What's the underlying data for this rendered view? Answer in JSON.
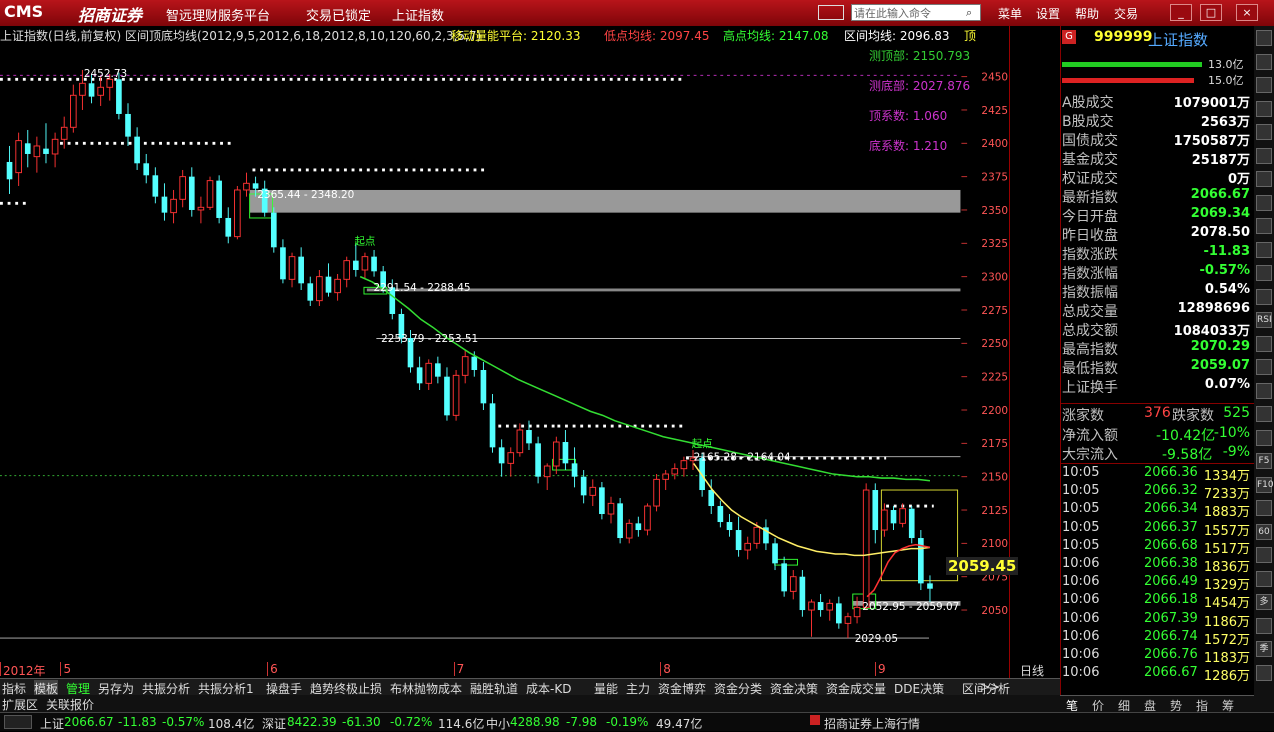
{
  "titlebar": {
    "logo": "CMS",
    "brand": "招商证券",
    "menus": [
      "智远理财服务平台",
      "交易已锁定",
      "上证指数"
    ],
    "cmd_placeholder": "请在此输入命令",
    "right_menus": [
      "菜单",
      "设置",
      "帮助",
      "交易"
    ],
    "window_buttons": [
      "_",
      "□",
      "×"
    ]
  },
  "infobar": {
    "indicator": "上证指数(日线,前复权) 区间顶底均线(2012,9,5,2012,6,18,2012,8,10,120,60,2,3,5,7)",
    "move_platform": "移动量能平台: 2120.33",
    "low_avg": "低点均线: 2097.45",
    "high_avg": "高点均线: 2147.08",
    "range_avg": "区间均线: 2096.83",
    "top": "顶"
  },
  "chart_data": {
    "type": "candlestick",
    "y_ticks": [
      2450,
      2425,
      2400,
      2375,
      2350,
      2325,
      2300,
      2275,
      2250,
      2225,
      2200,
      2175,
      2150,
      2125,
      2100,
      2075,
      2050
    ],
    "ylim": [
      2022,
      2465
    ],
    "x_labels": [
      {
        "label": "2012年",
        "pos": 0.0
      },
      {
        "label": "5",
        "pos": 0.06
      },
      {
        "label": "6",
        "pos": 0.265
      },
      {
        "label": "7",
        "pos": 0.45
      },
      {
        "label": "8",
        "pos": 0.655
      },
      {
        "label": "9",
        "pos": 0.868
      }
    ],
    "annotations": [
      {
        "text": "测顶部: 2150.793",
        "color": "#33cc33"
      },
      {
        "text": "测底部: 2027.876",
        "color": "#cc33cc"
      },
      {
        "text": "顶系数: 1.060",
        "color": "#cc33cc"
      },
      {
        "text": "底系数: 1.210",
        "color": "#cc33cc"
      }
    ],
    "level_labels": [
      {
        "text": "2452.73",
        "y": 2452.73
      },
      {
        "text": "2365.44 - 2348.20",
        "y": 2365.44
      },
      {
        "text": "2291.54 - 2288.45",
        "y": 2291.54
      },
      {
        "text": "2253.79 - 2253.51",
        "y": 2253.79
      },
      {
        "text": "2165.28 - 2164.04",
        "y": 2165.28
      },
      {
        "text": "2052.95 - 2059.07",
        "y": 2052.95
      },
      {
        "text": "2029.05",
        "y": 2029.05
      },
      {
        "text": "起点",
        "y": 2320
      },
      {
        "text": "起点",
        "y": 2168
      }
    ],
    "price_marker": "2059.45",
    "period": "日线",
    "candles": [
      [
        2386,
        2398,
        2362,
        2373
      ],
      [
        2378,
        2408,
        2368,
        2402
      ],
      [
        2400,
        2410,
        2382,
        2392
      ],
      [
        2390,
        2405,
        2378,
        2398
      ],
      [
        2396,
        2415,
        2385,
        2392
      ],
      [
        2392,
        2408,
        2382,
        2403
      ],
      [
        2403,
        2420,
        2396,
        2412
      ],
      [
        2412,
        2444,
        2408,
        2436
      ],
      [
        2436,
        2455,
        2425,
        2445
      ],
      [
        2445,
        2452,
        2430,
        2435
      ],
      [
        2436,
        2450,
        2428,
        2442
      ],
      [
        2442,
        2452,
        2432,
        2448
      ],
      [
        2448,
        2453,
        2418,
        2422
      ],
      [
        2422,
        2430,
        2398,
        2405
      ],
      [
        2405,
        2412,
        2380,
        2385
      ],
      [
        2385,
        2392,
        2370,
        2376
      ],
      [
        2376,
        2382,
        2355,
        2360
      ],
      [
        2360,
        2370,
        2342,
        2348
      ],
      [
        2348,
        2365,
        2340,
        2358
      ],
      [
        2358,
        2380,
        2352,
        2375
      ],
      [
        2375,
        2382,
        2345,
        2350
      ],
      [
        2350,
        2360,
        2340,
        2352
      ],
      [
        2352,
        2375,
        2350,
        2372
      ],
      [
        2372,
        2376,
        2340,
        2344
      ],
      [
        2344,
        2352,
        2325,
        2330
      ],
      [
        2330,
        2368,
        2328,
        2365
      ],
      [
        2365,
        2378,
        2360,
        2370
      ],
      [
        2370,
        2375,
        2360,
        2366
      ],
      [
        2366,
        2372,
        2345,
        2348
      ],
      [
        2348,
        2352,
        2318,
        2322
      ],
      [
        2322,
        2328,
        2295,
        2298
      ],
      [
        2298,
        2318,
        2292,
        2315
      ],
      [
        2315,
        2322,
        2290,
        2295
      ],
      [
        2295,
        2300,
        2278,
        2282
      ],
      [
        2282,
        2305,
        2278,
        2300
      ],
      [
        2300,
        2310,
        2285,
        2288
      ],
      [
        2288,
        2302,
        2282,
        2298
      ],
      [
        2298,
        2315,
        2292,
        2312
      ],
      [
        2312,
        2325,
        2300,
        2305
      ],
      [
        2305,
        2318,
        2298,
        2315
      ],
      [
        2315,
        2320,
        2300,
        2304
      ],
      [
        2304,
        2308,
        2288,
        2292
      ],
      [
        2292,
        2298,
        2268,
        2272
      ],
      [
        2272,
        2276,
        2250,
        2254
      ],
      [
        2254,
        2260,
        2228,
        2232
      ],
      [
        2232,
        2240,
        2215,
        2220
      ],
      [
        2220,
        2238,
        2215,
        2235
      ],
      [
        2235,
        2240,
        2220,
        2225
      ],
      [
        2225,
        2232,
        2192,
        2196
      ],
      [
        2196,
        2230,
        2192,
        2226
      ],
      [
        2226,
        2245,
        2220,
        2240
      ],
      [
        2240,
        2244,
        2225,
        2230
      ],
      [
        2230,
        2236,
        2200,
        2205
      ],
      [
        2205,
        2212,
        2168,
        2172
      ],
      [
        2172,
        2178,
        2150,
        2160
      ],
      [
        2160,
        2172,
        2150,
        2168
      ],
      [
        2168,
        2190,
        2165,
        2185
      ],
      [
        2185,
        2192,
        2170,
        2175
      ],
      [
        2175,
        2180,
        2145,
        2150
      ],
      [
        2150,
        2160,
        2140,
        2158
      ],
      [
        2158,
        2180,
        2152,
        2176
      ],
      [
        2176,
        2185,
        2155,
        2160
      ],
      [
        2160,
        2172,
        2142,
        2150
      ],
      [
        2150,
        2155,
        2130,
        2136
      ],
      [
        2136,
        2148,
        2128,
        2142
      ],
      [
        2142,
        2146,
        2118,
        2122
      ],
      [
        2122,
        2135,
        2115,
        2130
      ],
      [
        2130,
        2134,
        2100,
        2104
      ],
      [
        2104,
        2118,
        2100,
        2115
      ],
      [
        2115,
        2120,
        2105,
        2110
      ],
      [
        2110,
        2130,
        2106,
        2128
      ],
      [
        2128,
        2152,
        2124,
        2148
      ],
      [
        2148,
        2155,
        2140,
        2152
      ],
      [
        2152,
        2160,
        2148,
        2156
      ],
      [
        2156,
        2165,
        2150,
        2162
      ],
      [
        2162,
        2170,
        2155,
        2164
      ],
      [
        2164,
        2168,
        2135,
        2140
      ],
      [
        2140,
        2148,
        2122,
        2128
      ],
      [
        2128,
        2132,
        2112,
        2116
      ],
      [
        2116,
        2122,
        2105,
        2110
      ],
      [
        2110,
        2120,
        2090,
        2095
      ],
      [
        2095,
        2105,
        2088,
        2100
      ],
      [
        2100,
        2116,
        2096,
        2112
      ],
      [
        2112,
        2118,
        2095,
        2100
      ],
      [
        2100,
        2104,
        2080,
        2085
      ],
      [
        2085,
        2090,
        2060,
        2064
      ],
      [
        2064,
        2080,
        2058,
        2075
      ],
      [
        2075,
        2080,
        2045,
        2050
      ],
      [
        2050,
        2058,
        2030,
        2056
      ],
      [
        2056,
        2062,
        2045,
        2050
      ],
      [
        2050,
        2058,
        2042,
        2055
      ],
      [
        2055,
        2060,
        2036,
        2040
      ],
      [
        2040,
        2048,
        2029,
        2045
      ],
      [
        2045,
        2060,
        2040,
        2052
      ],
      [
        2052,
        2145,
        2050,
        2140
      ],
      [
        2140,
        2145,
        2100,
        2110
      ],
      [
        2110,
        2130,
        2105,
        2125
      ],
      [
        2125,
        2128,
        2110,
        2115
      ],
      [
        2115,
        2130,
        2112,
        2126
      ],
      [
        2126,
        2128,
        2100,
        2104
      ],
      [
        2104,
        2110,
        2065,
        2070
      ],
      [
        2070,
        2076,
        2056,
        2066
      ]
    ],
    "green_ma": [
      2300,
      2296,
      2290,
      2283,
      2276,
      2268,
      2262,
      2255,
      2249,
      2243,
      2238,
      2233,
      2228,
      2223,
      2219,
      2215,
      2211,
      2207,
      2203,
      2199,
      2196,
      2192,
      2189,
      2186,
      2183,
      2180,
      2178,
      2176,
      2174,
      2172,
      2170,
      2168,
      2166,
      2164,
      2162,
      2160,
      2158,
      2156,
      2154,
      2152,
      2151,
      2150,
      2150,
      2149,
      2149,
      2148,
      2148,
      2147
    ],
    "yellow_ma": [
      2160,
      2150,
      2140,
      2132,
      2125,
      2120,
      2116,
      2112,
      2108,
      2104,
      2101,
      2098,
      2096,
      2094,
      2093,
      2092,
      2092,
      2091,
      2091,
      2092,
      2093,
      2094,
      2095,
      2096,
      2096,
      2097
    ],
    "red_ma": [
      2060,
      2065,
      2075,
      2086,
      2093,
      2096,
      2098,
      2099,
      2098,
      2097
    ]
  },
  "quote": {
    "code": "999999",
    "name": "上证指数",
    "vol_up": "13.0亿",
    "vol_down": "15.0亿",
    "rows": [
      {
        "label": "A股成交",
        "value": "1079001万",
        "color": "#ffffff"
      },
      {
        "label": "B股成交",
        "value": "2563万",
        "color": "#ffffff"
      },
      {
        "label": "国债成交",
        "value": "1750587万",
        "color": "#ffffff"
      },
      {
        "label": "基金成交",
        "value": "25187万",
        "color": "#ffffff"
      },
      {
        "label": "权证成交",
        "value": "0万",
        "color": "#ffffff"
      },
      {
        "label": "最新指数",
        "value": "2066.67",
        "color": "#33ff33"
      },
      {
        "label": "今日开盘",
        "value": "2069.34",
        "color": "#33ff33"
      },
      {
        "label": "昨日收盘",
        "value": "2078.50",
        "color": "#ffffff"
      },
      {
        "label": "指数涨跌",
        "value": "-11.83",
        "color": "#33ff33"
      },
      {
        "label": "指数涨幅",
        "value": "-0.57%",
        "color": "#33ff33"
      },
      {
        "label": "指数振幅",
        "value": "0.54%",
        "color": "#ffffff"
      },
      {
        "label": "总成交量",
        "value": "12898696",
        "color": "#ffffff"
      },
      {
        "label": "总成交额",
        "value": "1084033万",
        "color": "#ffffff"
      },
      {
        "label": "最高指数",
        "value": "2070.29",
        "color": "#33ff33"
      },
      {
        "label": "最低指数",
        "value": "2059.07",
        "color": "#33ff33"
      },
      {
        "label": "上证换手",
        "value": "0.07%",
        "color": "#ffffff"
      }
    ],
    "rise_label": "涨家数",
    "rise_count": "376",
    "fall_label": "跌家数",
    "fall_count": "525",
    "inflow_label": "净流入额",
    "inflow_value": "-10.42亿",
    "inflow_pct": "-10%",
    "block_label": "大宗流入",
    "block_value": "-9.58亿",
    "block_pct": "-9%"
  },
  "ticks": [
    {
      "time": "10:05",
      "price": "2066.36",
      "vol": "1334万"
    },
    {
      "time": "10:05",
      "price": "2066.32",
      "vol": "7233万"
    },
    {
      "time": "10:05",
      "price": "2066.34",
      "vol": "1883万"
    },
    {
      "time": "10:05",
      "price": "2066.37",
      "vol": "1557万"
    },
    {
      "time": "10:05",
      "price": "2066.68",
      "vol": "1517万"
    },
    {
      "time": "10:06",
      "price": "2066.38",
      "vol": "1836万"
    },
    {
      "time": "10:06",
      "price": "2066.49",
      "vol": "1329万"
    },
    {
      "time": "10:06",
      "price": "2066.18",
      "vol": "1454万"
    },
    {
      "time": "10:06",
      "price": "2067.39",
      "vol": "1186万"
    },
    {
      "time": "10:06",
      "price": "2066.74",
      "vol": "1572万"
    },
    {
      "time": "10:06",
      "price": "2066.76",
      "vol": "1183万"
    },
    {
      "time": "10:06",
      "price": "2066.67",
      "vol": "1286万"
    }
  ],
  "toolbar": {
    "tabs": [
      "指标",
      "模板",
      "管理",
      "另存为",
      "共振分析",
      "共振分析1",
      "操盘手",
      "趋势终极止损",
      "布林抛物成本",
      "融胜轨道",
      "成本-KD",
      "量能",
      "主力",
      "资金博弈",
      "资金分类",
      "资金决策",
      "资金成交量",
      "DDE决策",
      "区间分析"
    ],
    "more": ">>",
    "period_label": "日线",
    "ext": [
      "扩展区",
      "关联报价"
    ]
  },
  "right_tabs": [
    "笔",
    "价",
    "细",
    "盘",
    "势",
    "指",
    "筹"
  ],
  "statusbar": {
    "sh_name": "上证",
    "sh_price": "2066.67",
    "sh_chg": "-11.83",
    "sh_pct": "-0.57%",
    "sh_amt": "108.4亿",
    "sz_name": "深证",
    "sz_price": "8422.39",
    "sz_chg": "-61.30",
    "sz_pct": "-0.72%",
    "sz_amt": "114.6亿",
    "zx_name": "中小",
    "zx_price": "4288.98",
    "zx_chg": "-7.98",
    "zx_pct": "-0.19%",
    "zx_amt": "49.47亿",
    "server": "招商证券上海行情"
  },
  "icon_strip": [
    "RSI",
    "F5",
    "F10",
    "60",
    "多",
    "季"
  ]
}
